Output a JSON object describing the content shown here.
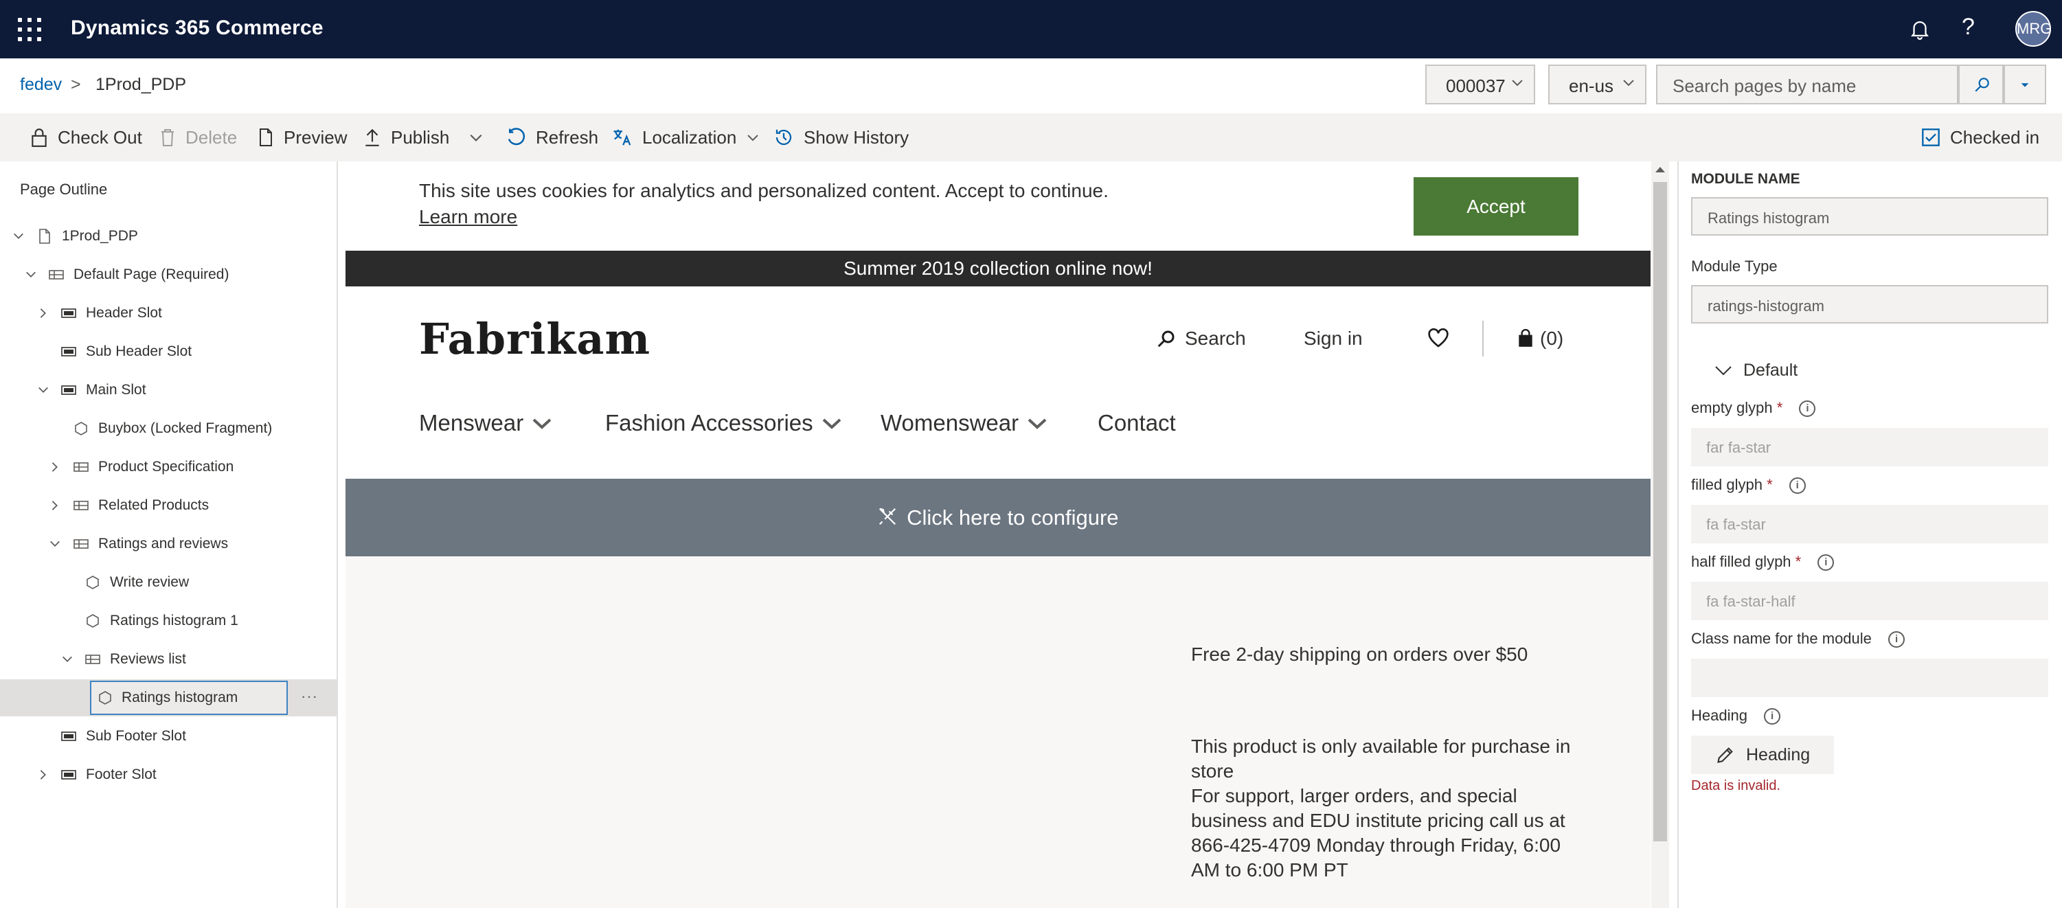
{
  "app": {
    "title": "Dynamics 365 Commerce",
    "user_initials": "MRG"
  },
  "breadcrumb": {
    "site": "fedev",
    "separator": ">",
    "page": "1Prod_PDP"
  },
  "selectors": {
    "channel": "000037",
    "locale": "en-us"
  },
  "search": {
    "placeholder": "Search pages by name"
  },
  "commands": {
    "checkout": "Check Out",
    "delete": "Delete",
    "preview": "Preview",
    "publish": "Publish",
    "refresh": "Refresh",
    "localization": "Localization",
    "history": "Show History",
    "checked_in": "Checked in"
  },
  "outline": {
    "title": "Page Outline",
    "items": [
      {
        "label": "1Prod_PDP"
      },
      {
        "label": "Default Page (Required)"
      },
      {
        "label": "Header Slot"
      },
      {
        "label": "Sub Header Slot"
      },
      {
        "label": "Main Slot"
      },
      {
        "label": "Buybox (Locked Fragment)"
      },
      {
        "label": "Product Specification"
      },
      {
        "label": "Related Products"
      },
      {
        "label": "Ratings and reviews"
      },
      {
        "label": "Write review"
      },
      {
        "label": "Ratings histogram 1"
      },
      {
        "label": "Reviews list"
      },
      {
        "label": "Ratings histogram"
      },
      {
        "label": "Sub Footer Slot"
      },
      {
        "label": "Footer Slot"
      }
    ],
    "more": "···"
  },
  "preview": {
    "cookie_text": "This site uses cookies for analytics and personalized content. Accept to continue.",
    "cookie_link": "Learn more",
    "accept": "Accept",
    "promo": "Summer 2019 collection online now!",
    "logo": "Fabrikam",
    "search": "Search",
    "signin": "Sign in",
    "cart": "(0)",
    "nav": [
      "Menswear",
      "Fashion Accessories",
      "Womenswear",
      "Contact"
    ],
    "configure": "Click here to configure",
    "shipping": "Free 2-day shipping on orders over $50",
    "store_only": "This product is only available for purchase in store",
    "support": "For support, larger orders, and special business and EDU institute pricing call us at 866-425-4709 Monday through Friday, 6:00 AM to 6:00 PM PT"
  },
  "properties": {
    "module_name_label": "MODULE NAME",
    "module_name": "Ratings histogram",
    "module_type_label": "Module Type",
    "module_type": "ratings-histogram",
    "section": "Default",
    "empty_glyph_label": "empty glyph",
    "empty_glyph": "far fa-star",
    "filled_glyph_label": "filled glyph",
    "filled_glyph": "fa fa-star",
    "half_glyph_label": "half filled glyph",
    "half_glyph": "fa fa-star-half",
    "class_label": "Class name for the module",
    "class_value": "",
    "heading_label": "Heading",
    "heading_button": "Heading",
    "error": "Data is invalid.",
    "required_mark": "*",
    "info_glyph": "i"
  }
}
